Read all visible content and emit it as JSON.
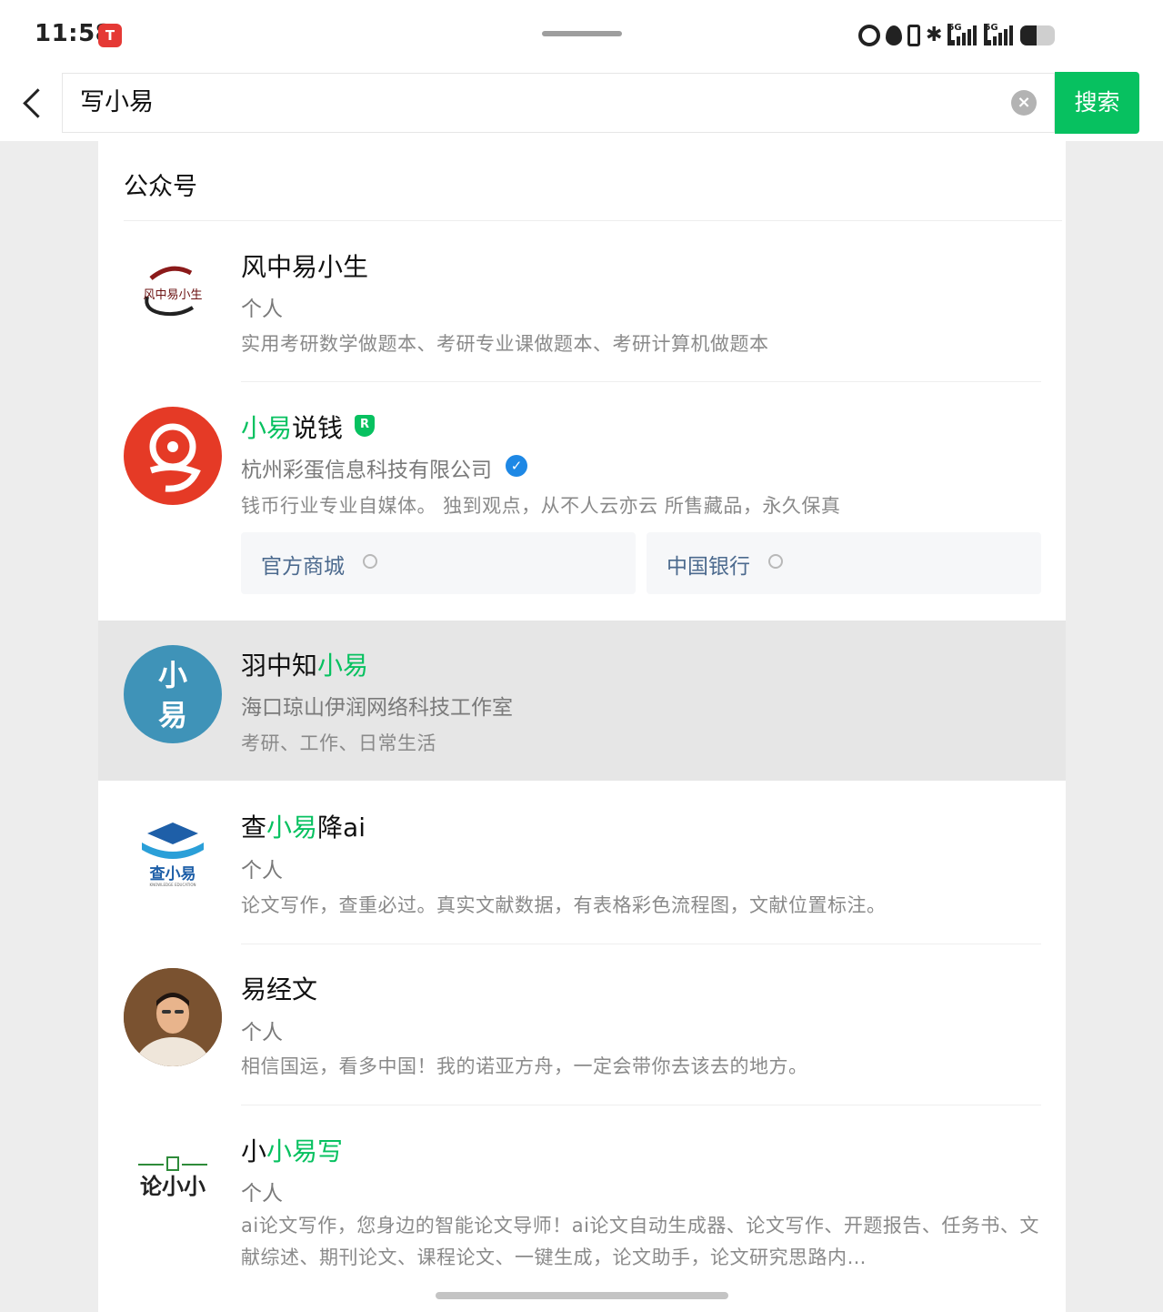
{
  "status_bar": {
    "time": "11:58",
    "app_badge": "T",
    "bluetooth": "✱",
    "network_1": "5G",
    "network_2": "5G",
    "battery_level": 0.45
  },
  "search": {
    "query": "写小易",
    "clear_icon": "×",
    "button_label": "搜索"
  },
  "section": {
    "title": "公众号"
  },
  "results": [
    {
      "name": "风中易小生",
      "type": "个人",
      "desc": "实用考研数学做题本、考研专业课做题本、考研计算机做题本",
      "avatar_text": "风中易小生"
    },
    {
      "name_hl": "小易",
      "name_rest": "说钱",
      "badge": "R",
      "company": "杭州彩蛋信息科技有限公司",
      "verified_mark": "✓",
      "desc": "钱币行业专业自媒体。 独到观点，从不人云亦云 所售藏品，永久保真",
      "links": [
        "官方商城",
        "中国银行"
      ]
    },
    {
      "name_pre": "羽中知",
      "name_hl": "小易",
      "company": "海口琼山伊润网络科技工作室",
      "desc": "考研、工作、日常生活",
      "avatar_text": [
        "小",
        "易"
      ]
    },
    {
      "name_pre": "查",
      "name_hl": "小易",
      "name_rest": "降ai",
      "type": "个人",
      "desc": "论文写作，查重必过。真实文献数据，有表格彩色流程图，文献位置标注。",
      "avatar_text": "查小易",
      "avatar_subtext": "KNOWLEDGE EDUCATION"
    },
    {
      "name": "易经文",
      "type": "个人",
      "desc": "相信国运，看多中国！我的诺亚方舟，一定会带你去该去的地方。"
    },
    {
      "name_pre": "小",
      "name_hl": "小易写",
      "type": "个人",
      "desc": "ai论文写作，您身边的智能论文导师！ai论文自动生成器、论文写作、开题报告、任务书、文献综述、期刊论文、课程论文、一键生成，论文助手，论文研究思路内…",
      "avatar_text": "论小小"
    }
  ],
  "colors": {
    "accent": "#07c160",
    "link": "#4c6a8e",
    "verified": "#1e88e5",
    "highlight_bg": "#e6e6e6"
  }
}
